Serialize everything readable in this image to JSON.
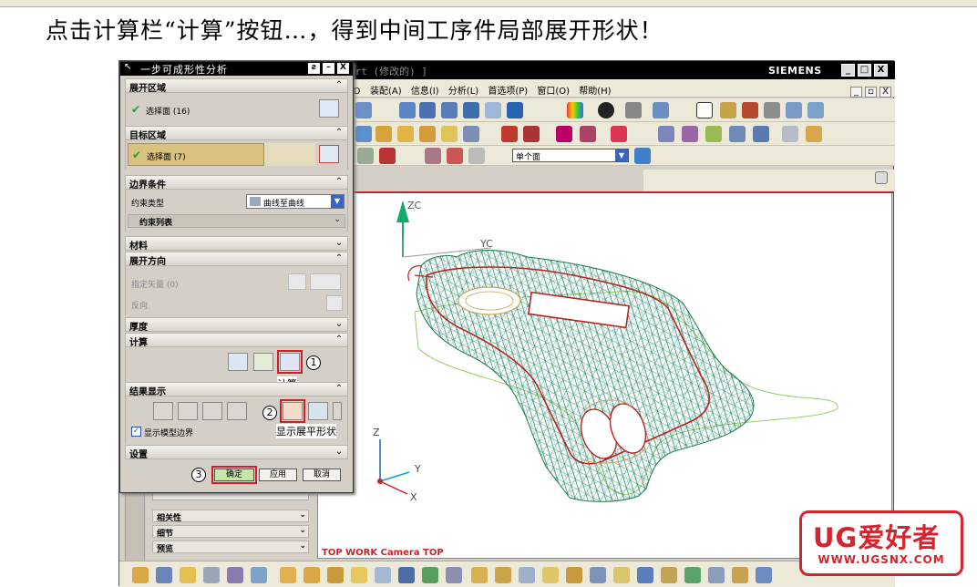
{
  "caption": "点击计算栏“计算”按钮…，得到中间工序件局部展开形状！",
  "window": {
    "doc_title": "prt (修改的) ]",
    "brand": "SIEMENS",
    "buttons": [
      "_",
      "□",
      "X"
    ]
  },
  "menu": {
    "items": [
      "Ɒ",
      "装配(A)",
      "信息(I)",
      "分析(L)",
      "首选项(P)",
      "窗口(O)",
      "帮助(H)"
    ],
    "mdi_buttons": [
      "_",
      "▫",
      "X"
    ]
  },
  "toolbar": {
    "selection_filter": "单个面"
  },
  "viewport": {
    "label": "TOP WORK Camera TOP",
    "axis_labels": {
      "zc": "ZC",
      "yc": "YC",
      "z": "Z",
      "y": "Y",
      "x": "X"
    }
  },
  "dialog": {
    "title": "一步可成形性分析",
    "title_buttons": [
      "ƨ",
      "–",
      "X"
    ],
    "sections": {
      "unfold_region": {
        "label": "展开区域",
        "select_text": "选择面 (16)"
      },
      "target_region": {
        "label": "目标区域",
        "select_text": "选择面 (7)"
      },
      "boundary": {
        "label": "边界条件",
        "constraint_type_label": "约束类型",
        "constraint_type_value": "曲线至曲线",
        "constraint_list_label": "约束列表"
      },
      "material": {
        "label": "材料"
      },
      "unfold_direction": {
        "label": "展开方向",
        "vector_label": "指定矢量 (0)",
        "reverse_label": "反向"
      },
      "thickness": {
        "label": "厚度"
      },
      "compute": {
        "label": "计算",
        "compute_caption": "计算"
      },
      "result_display": {
        "label": "结果显示",
        "show_boundary_label": "显示模型边界",
        "flat_caption": "显示展平形状"
      },
      "settings": {
        "label": "设置"
      }
    },
    "buttons": {
      "ok": "确定",
      "apply": "应用",
      "cancel": "取消"
    },
    "step_numbers": [
      "1",
      "2",
      "3"
    ]
  },
  "left_panel": {
    "items": [
      "相关性",
      "细节",
      "预览"
    ]
  },
  "logo": {
    "text": "UG爱好者",
    "url": "WWW.UGSNX.COM"
  }
}
